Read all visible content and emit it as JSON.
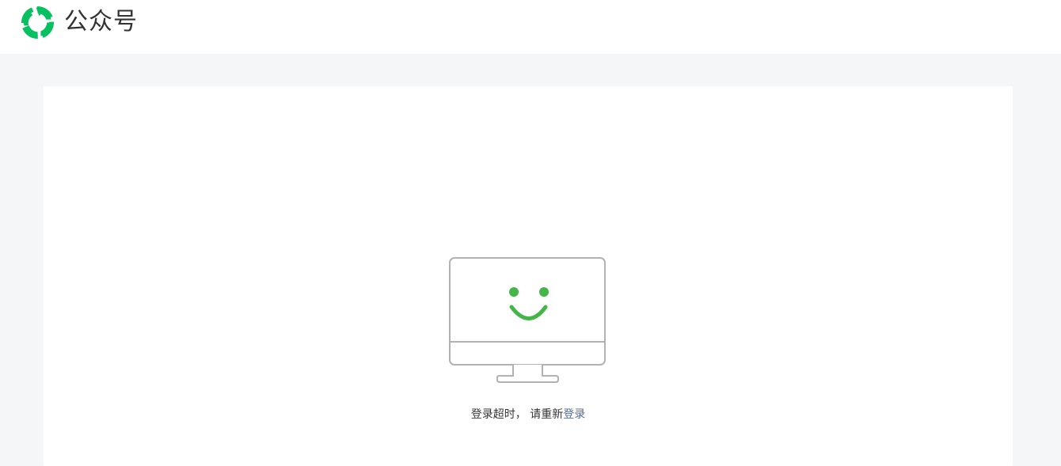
{
  "header": {
    "brand_title": "公众号",
    "logo_icon": "wechat-official-account-logo-icon",
    "brand_color": "#07c160"
  },
  "main": {
    "illustration_icon": "monitor-smiley-icon",
    "message_text": "登录超时， 请重新",
    "login_link_label": "登录",
    "accent_color": "#44b549",
    "link_color": "#576b95"
  }
}
